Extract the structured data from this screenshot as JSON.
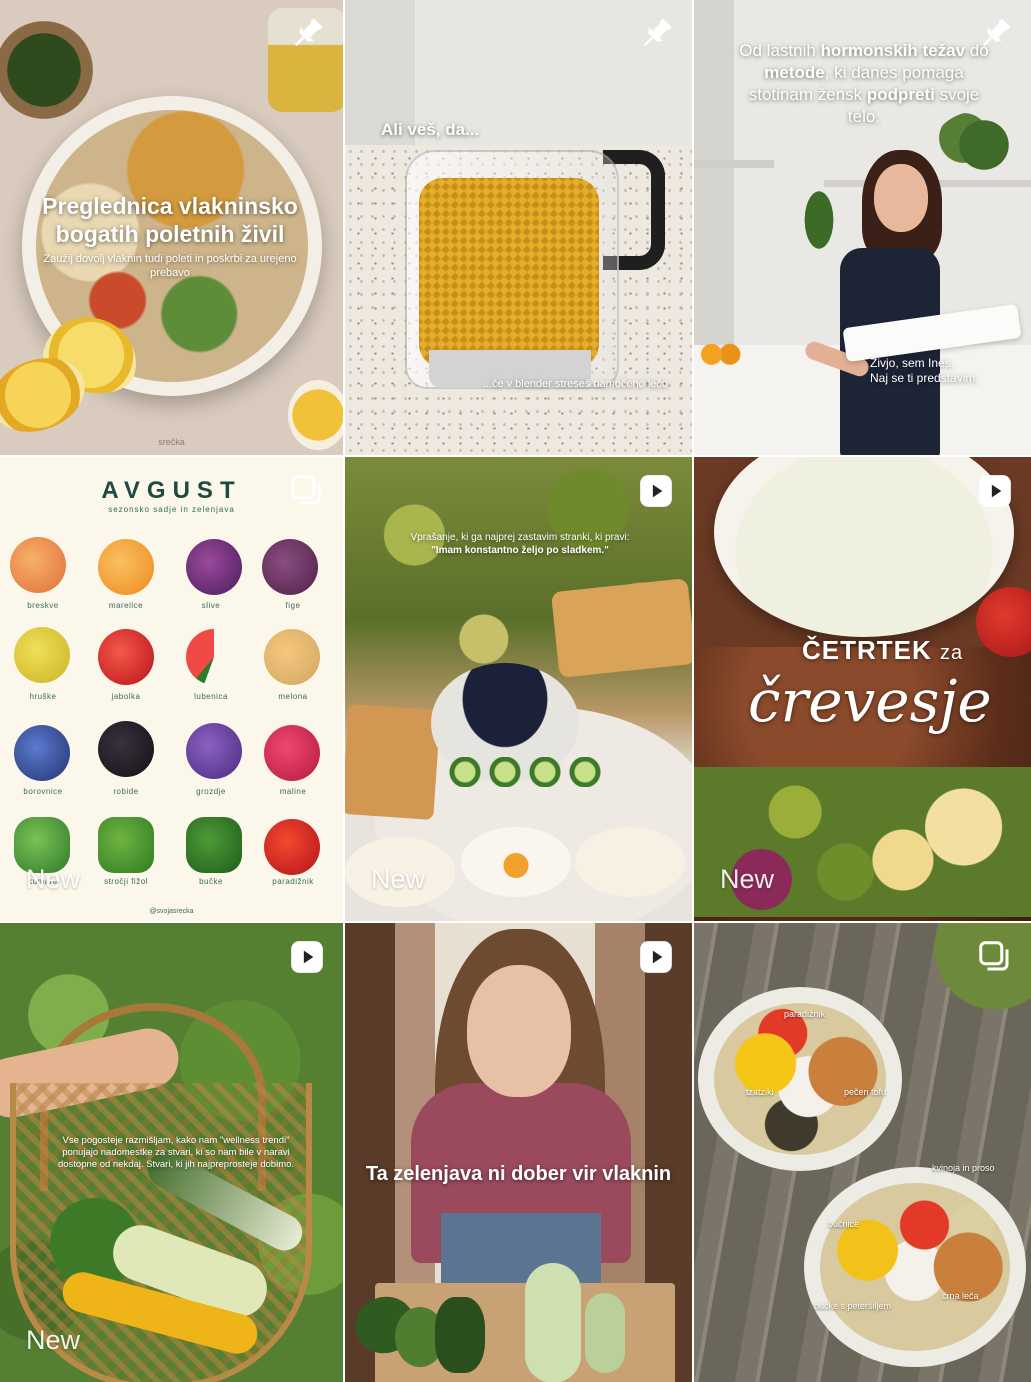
{
  "tiles": [
    {
      "badge": "pin-icon",
      "title": "Preglednica vlakninsko bogatih poletnih živil",
      "subtitle": "Zaužij dovolj vlaknin tudi poleti in poskrbi za urejeno prebavo",
      "brand": "srečka"
    },
    {
      "badge": "pin-icon",
      "question": "Ali veš, da...",
      "caption": "...če v blender streseš namočeno lečo"
    },
    {
      "badge": "pin-icon",
      "headline_1": "Od lastnih ",
      "headline_b1": "hormonskih težav",
      "headline_2": " do ",
      "headline_b2": "metode",
      "headline_3": ", ki danes pomaga stotinam žensk ",
      "headline_b3": "podpreti",
      "headline_4": " svoje telo.",
      "greeting_1": "Živjo, sem Ines.",
      "greeting_2": "Naj se ti predstavim."
    },
    {
      "badge": "carousel-icon",
      "title": "AVGUST",
      "subtitle": "sezonsko sadje in zelenjava",
      "items": [
        "breskve",
        "marelice",
        "slive",
        "fige",
        "hruške",
        "jabolka",
        "lubenica",
        "melona",
        "borovnice",
        "robide",
        "grozdje",
        "maline",
        "kumare",
        "stročji fižol",
        "bučke",
        "paradižnik"
      ],
      "footer": "@svojasrecka",
      "new_label": "New"
    },
    {
      "badge": "reel-icon",
      "question_1": "Vprašanje, ki ga najprej zastavim stranki, ki pravi:",
      "question_2": "\"Imam konstantno željo po sladkem.\"",
      "new_label": "New"
    },
    {
      "badge": "reel-icon",
      "title_1": "ČETRTEK",
      "title_2": "za",
      "title_3": "črevesje",
      "new_label": "New"
    },
    {
      "badge": "reel-icon",
      "text": "Vse pogosteje razmišljam, kako nam \"wellness trendi\" ponujajo nadomestke za stvari, ki so nam bile v naravi dostopne od nekdaj. Stvari, ki jih najpreprosteje dobimo.",
      "new_label": "New"
    },
    {
      "badge": "reel-icon",
      "caption": "Ta zelenjava ni dober vir vlaknin"
    },
    {
      "badge": "carousel-icon",
      "labels": [
        "paradižnik",
        "tzatziki",
        "pečen tofu",
        "kvinoja in proso",
        "bučnice",
        "bučke s peteršiljem",
        "črna leča"
      ]
    }
  ]
}
